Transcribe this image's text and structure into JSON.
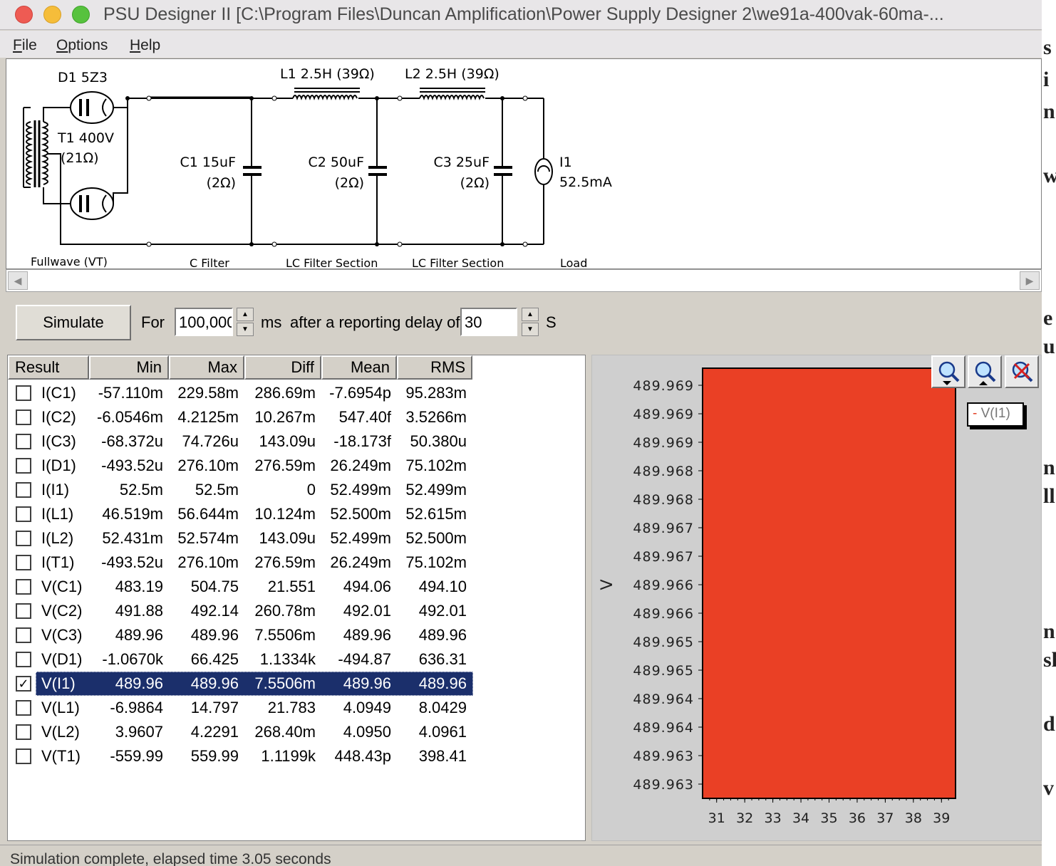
{
  "window": {
    "title": "PSU Designer II  [C:\\Program Files\\Duncan Amplification\\Power Supply Designer 2\\we91a-400vak-60ma-..."
  },
  "menu": [
    {
      "accel": "F",
      "rest": "ile"
    },
    {
      "accel": "O",
      "rest": "ptions"
    },
    {
      "accel": "H",
      "rest": "elp"
    }
  ],
  "schematic": {
    "d1": "D1 5Z3",
    "t1_a": "T1 400V",
    "t1_b": "(21Ω)",
    "l1": "L1 2.5H (39Ω)",
    "l2": "L2 2.5H (39Ω)",
    "c1_a": "C1 15uF",
    "c1_b": "(2Ω)",
    "c2_a": "C2 50uF",
    "c2_b": "(2Ω)",
    "c3_a": "C3 25uF",
    "c3_b": "(2Ω)",
    "i1_a": "I1",
    "i1_b": "52.5mA",
    "sec_fullwave": "Fullwave (VT)",
    "sec_cfilter": "C Filter",
    "sec_lc1": "LC Filter Section",
    "sec_lc2": "LC Filter Section",
    "sec_load": "Load"
  },
  "controls": {
    "simulate": "Simulate",
    "for_label": "For",
    "duration": "100,000",
    "ms_label": "ms",
    "delay_label": "after a reporting delay of",
    "delay": "30",
    "s_label": "S"
  },
  "results": {
    "headers": [
      "Result",
      "Min",
      "Max",
      "Diff",
      "Mean",
      "RMS"
    ],
    "rows": [
      {
        "name": "I(C1)",
        "min": "-57.110m",
        "max": "229.58m",
        "diff": "286.69m",
        "mean": "-7.6954p",
        "rms": "95.283m",
        "checked": false
      },
      {
        "name": "I(C2)",
        "min": "-6.0546m",
        "max": "4.2125m",
        "diff": "10.267m",
        "mean": "547.40f",
        "rms": "3.5266m",
        "checked": false
      },
      {
        "name": "I(C3)",
        "min": "-68.372u",
        "max": "74.726u",
        "diff": "143.09u",
        "mean": "-18.173f",
        "rms": "50.380u",
        "checked": false
      },
      {
        "name": "I(D1)",
        "min": "-493.52u",
        "max": "276.10m",
        "diff": "276.59m",
        "mean": "26.249m",
        "rms": "75.102m",
        "checked": false
      },
      {
        "name": "I(I1)",
        "min": "52.5m",
        "max": "52.5m",
        "diff": "0",
        "mean": "52.499m",
        "rms": "52.499m",
        "checked": false
      },
      {
        "name": "I(L1)",
        "min": "46.519m",
        "max": "56.644m",
        "diff": "10.124m",
        "mean": "52.500m",
        "rms": "52.615m",
        "checked": false
      },
      {
        "name": "I(L2)",
        "min": "52.431m",
        "max": "52.574m",
        "diff": "143.09u",
        "mean": "52.499m",
        "rms": "52.500m",
        "checked": false
      },
      {
        "name": "I(T1)",
        "min": "-493.52u",
        "max": "276.10m",
        "diff": "276.59m",
        "mean": "26.249m",
        "rms": "75.102m",
        "checked": false
      },
      {
        "name": "V(C1)",
        "min": "483.19",
        "max": "504.75",
        "diff": "21.551",
        "mean": "494.06",
        "rms": "494.10",
        "checked": false
      },
      {
        "name": "V(C2)",
        "min": "491.88",
        "max": "492.14",
        "diff": "260.78m",
        "mean": "492.01",
        "rms": "492.01",
        "checked": false
      },
      {
        "name": "V(C3)",
        "min": "489.96",
        "max": "489.96",
        "diff": "7.5506m",
        "mean": "489.96",
        "rms": "489.96",
        "checked": false
      },
      {
        "name": "V(D1)",
        "min": "-1.0670k",
        "max": "66.425",
        "diff": "1.1334k",
        "mean": "-494.87",
        "rms": "636.31",
        "checked": false
      },
      {
        "name": "V(I1)",
        "min": "489.96",
        "max": "489.96",
        "diff": "7.5506m",
        "mean": "489.96",
        "rms": "489.96",
        "checked": true
      },
      {
        "name": "V(L1)",
        "min": "-6.9864",
        "max": "14.797",
        "diff": "21.783",
        "mean": "4.0949",
        "rms": "8.0429",
        "checked": false
      },
      {
        "name": "V(L2)",
        "min": "3.9607",
        "max": "4.2291",
        "diff": "268.40m",
        "mean": "4.0950",
        "rms": "4.0961",
        "checked": false
      },
      {
        "name": "V(T1)",
        "min": "-559.99",
        "max": "559.99",
        "diff": "1.1199k",
        "mean": "448.43p",
        "rms": "398.41",
        "checked": false
      }
    ]
  },
  "chart_data": {
    "type": "area",
    "ylabel": "V",
    "y_ticks": [
      "489.969",
      "489.969",
      "489.969",
      "489.968",
      "489.968",
      "489.967",
      "489.967",
      "489.966",
      "489.966",
      "489.965",
      "489.965",
      "489.964",
      "489.964",
      "489.963",
      "489.963"
    ],
    "x_ticks": [
      "31",
      "32",
      "33",
      "34",
      "35",
      "36",
      "37",
      "38",
      "39"
    ],
    "xlim": [
      30.5,
      39.5
    ],
    "series": [
      {
        "name": "V(I1)",
        "color": "#ea4025",
        "fill": "full"
      }
    ],
    "legend": "top-right"
  },
  "status": {
    "text": "Simulation complete, elapsed time 3.05 seconds"
  },
  "colors": {
    "selection": "#1b2f6b",
    "trace": "#ea4025",
    "graph_bg": "#cfcfcf"
  }
}
